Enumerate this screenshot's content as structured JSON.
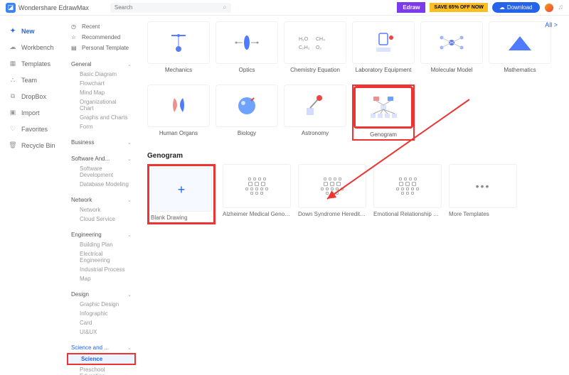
{
  "app": {
    "title": "Wondershare EdrawMax",
    "search_placeholder": "Search"
  },
  "topRight": {
    "edraw": "Edraw",
    "saveOff": "SAVE 65% OFF NOW",
    "download": "Download"
  },
  "allLink": "All >",
  "nav": [
    {
      "label": "New",
      "icon": "✦",
      "active": true
    },
    {
      "label": "Workbench",
      "icon": "☁"
    },
    {
      "label": "Templates",
      "icon": "▦"
    },
    {
      "label": "Team",
      "icon": "⛬"
    },
    {
      "label": "DropBox",
      "icon": "⧉"
    },
    {
      "label": "Import",
      "icon": "▣"
    },
    {
      "label": "Favorites",
      "icon": "♡"
    },
    {
      "label": "Recycle Bin",
      "icon": "🗑"
    }
  ],
  "sidebarTop": [
    {
      "label": "Recent",
      "icon": "◷"
    },
    {
      "label": "Recommended",
      "icon": "☆"
    },
    {
      "label": "Personal Template",
      "icon": "▤"
    }
  ],
  "categories": [
    {
      "name": "General",
      "expanded": true,
      "items": [
        "Basic Diagram",
        "Flowchart",
        "Mind Map",
        "Organizational Chart",
        "Graphs and Charts",
        "Form"
      ]
    },
    {
      "name": "Business",
      "expanded": false,
      "items": []
    },
    {
      "name": "Software And...",
      "expanded": true,
      "items": [
        "Software Development",
        "Database Modeling"
      ]
    },
    {
      "name": "Network",
      "expanded": true,
      "items": [
        "Network",
        "Cloud Service"
      ]
    },
    {
      "name": "Engineering",
      "expanded": true,
      "items": [
        "Building Plan",
        "Electrical Engineering",
        "Industrial Process",
        "Map"
      ]
    },
    {
      "name": "Design",
      "expanded": true,
      "items": [
        "Graphic Design",
        "Infographic",
        "Card",
        "UI&UX"
      ]
    },
    {
      "name": "Science and ...",
      "expanded": true,
      "active": true,
      "items": [
        "Science",
        "Preschool Education"
      ],
      "activeItem": "Science"
    }
  ],
  "cardsRow1": [
    {
      "label": "Mechanics"
    },
    {
      "label": "Optics"
    },
    {
      "label": "Chemistry Equation"
    },
    {
      "label": "Laboratory Equipment"
    },
    {
      "label": "Molecular Model"
    },
    {
      "label": "Mathematics"
    }
  ],
  "cardsRow2": [
    {
      "label": "Human Organs"
    },
    {
      "label": "Biology"
    },
    {
      "label": "Astronomy"
    },
    {
      "label": "Genogram",
      "highlight": true
    }
  ],
  "sectionTitle": "Genogram",
  "templates": [
    {
      "label": "Blank Drawing",
      "blank": true
    },
    {
      "label": "Alzheimer Medical Genogram"
    },
    {
      "label": "Down Syndrome Hereditary Genogram"
    },
    {
      "label": "Emotional Relationship Genogram"
    },
    {
      "label": "More Templates",
      "more": true
    }
  ]
}
